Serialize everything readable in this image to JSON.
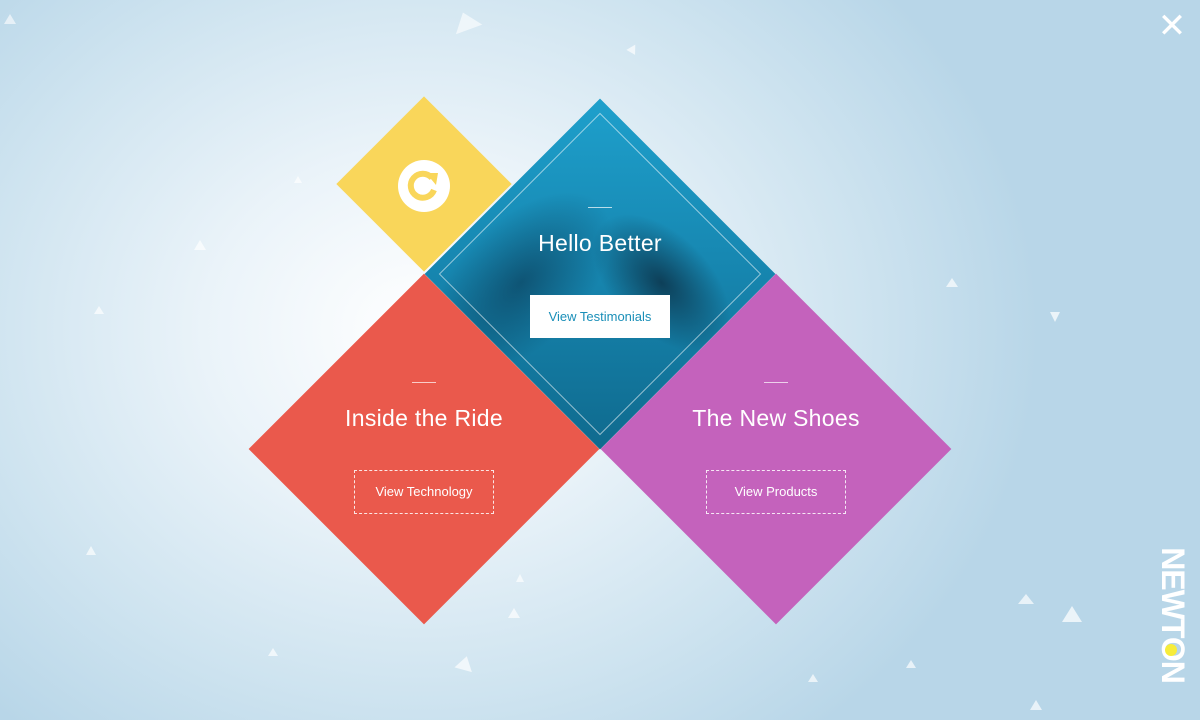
{
  "close": {
    "icon": "close-icon",
    "glyph": "✕"
  },
  "refresh": {
    "icon": "refresh-icon"
  },
  "panels": [
    {
      "title": "Hello Better",
      "button": "View Testimonials",
      "color": "#1a8fb8"
    },
    {
      "title": "Inside the Ride",
      "button": "View Technology",
      "color": "#ea594c"
    },
    {
      "title": "The New Shoes",
      "button": "View Products",
      "color": "#c462bc"
    }
  ],
  "colors": {
    "yellow": "#f9d65a",
    "teal": "#1a8fb8",
    "red": "#ea594c",
    "purple": "#c462bc",
    "brand_dot": "#f7ec3a"
  },
  "brand": {
    "text": "NEWTON",
    "logo": "newton-logo"
  }
}
